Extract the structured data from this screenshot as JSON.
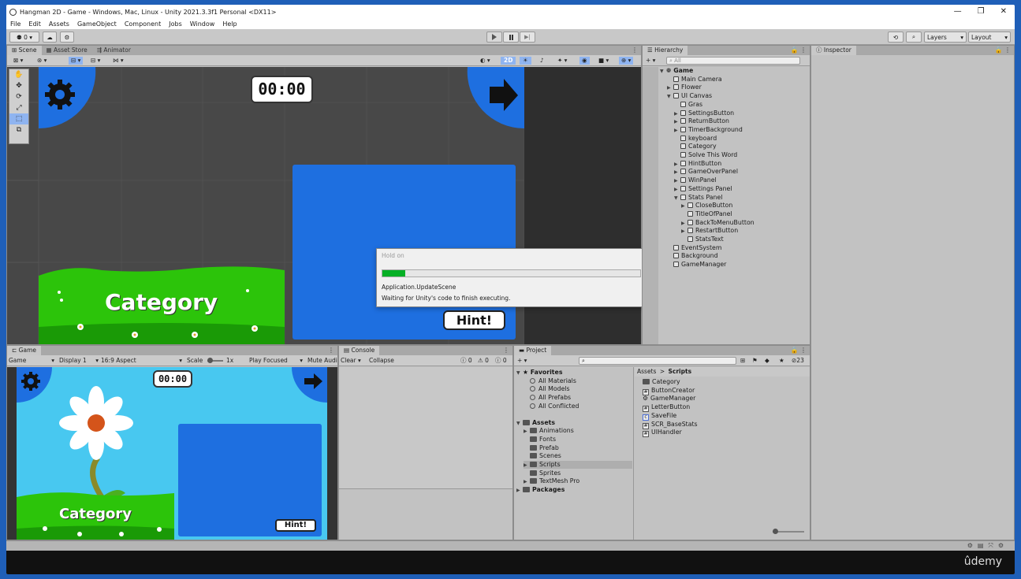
{
  "window": {
    "title": "Hangman 2D - Game - Windows, Mac, Linux - Unity 2021.3.3f1 Personal <DX11>",
    "min": "—",
    "restore": "❐",
    "close": "✕"
  },
  "menu": [
    "File",
    "Edit",
    "Assets",
    "GameObject",
    "Component",
    "Jobs",
    "Window",
    "Help"
  ],
  "toolbar": {
    "account": "⚉ 0 ▾",
    "cloud": "☁",
    "collab": "⚙",
    "layers": "Layers",
    "layout": "Layout"
  },
  "scene": {
    "tabs": [
      "Scene",
      "Asset Store",
      "Animator"
    ],
    "toggle_2d": "2D",
    "timer": "00:00",
    "category": "Category",
    "hint": "Hint!"
  },
  "dialog": {
    "title": "Hold on",
    "line1": "Application.UpdateScene",
    "line2": "Waiting for Unity's code to finish executing.",
    "progress": 0.09
  },
  "hierarchy": {
    "tab": "Hierarchy",
    "search_placeholder": "All",
    "root": "Game",
    "items": [
      {
        "label": "Main Camera",
        "depth": 1,
        "exp": false
      },
      {
        "label": "Flower",
        "depth": 1,
        "exp": true
      },
      {
        "label": "UI Canvas",
        "depth": 1,
        "exp": true,
        "open": true
      },
      {
        "label": "Gras",
        "depth": 2,
        "exp": false
      },
      {
        "label": "SettingsButton",
        "depth": 2,
        "exp": true
      },
      {
        "label": "ReturnButton",
        "depth": 2,
        "exp": true
      },
      {
        "label": "TimerBackground",
        "depth": 2,
        "exp": true
      },
      {
        "label": "keyboard",
        "depth": 2,
        "exp": false
      },
      {
        "label": "Category",
        "depth": 2,
        "exp": false
      },
      {
        "label": "Solve This Word",
        "depth": 2,
        "exp": false
      },
      {
        "label": "HintButton",
        "depth": 2,
        "exp": true
      },
      {
        "label": "GameOverPanel",
        "depth": 2,
        "exp": true
      },
      {
        "label": "WinPanel",
        "depth": 2,
        "exp": true
      },
      {
        "label": "Settings Panel",
        "depth": 2,
        "exp": true
      },
      {
        "label": "Stats Panel",
        "depth": 2,
        "exp": true,
        "open": true
      },
      {
        "label": "CloseButton",
        "depth": 3,
        "exp": true
      },
      {
        "label": "TitleOfPanel",
        "depth": 3,
        "exp": false
      },
      {
        "label": "BackToMenuButton",
        "depth": 3,
        "exp": true
      },
      {
        "label": "RestartButton",
        "depth": 3,
        "exp": true
      },
      {
        "label": "StatsText",
        "depth": 3,
        "exp": false
      },
      {
        "label": "EventSystem",
        "depth": 1,
        "exp": false
      },
      {
        "label": "Background",
        "depth": 1,
        "exp": false
      },
      {
        "label": "GameManager",
        "depth": 1,
        "exp": false
      }
    ]
  },
  "inspector": {
    "tab": "Inspector"
  },
  "game": {
    "tab": "Game",
    "mode": "Game",
    "display": "Display 1",
    "aspect": "16:9 Aspect",
    "scale_label": "Scale",
    "scale_value": "1x",
    "play": "Play Focused",
    "mute": "Mute Audi",
    "timer": "00:00",
    "category": "Category",
    "hint": "Hint!"
  },
  "console": {
    "tab": "Console",
    "clear": "Clear",
    "collapse": "Collapse",
    "count_info": "0",
    "count_warn": "0",
    "count_err": "0"
  },
  "project": {
    "tab": "Project",
    "hidden_count": "23",
    "favorites_label": "Favorites",
    "favorites": [
      "All Materials",
      "All Models",
      "All Prefabs",
      "All Conflicted"
    ],
    "assets_label": "Assets",
    "folders": [
      "Animations",
      "Fonts",
      "Prefab",
      "Scenes",
      "Scripts",
      "Sprites",
      "TextMesh Pro"
    ],
    "packages_label": "Packages",
    "breadcrumb_root": "Assets",
    "breadcrumb_sep": ">",
    "breadcrumb_leaf": "Scripts",
    "files": [
      {
        "name": "Category",
        "kind": "folder"
      },
      {
        "name": "ButtonCreator",
        "kind": "script"
      },
      {
        "name": "GameManager",
        "kind": "manager"
      },
      {
        "name": "LetterButton",
        "kind": "script"
      },
      {
        "name": "SaveFile",
        "kind": "cs"
      },
      {
        "name": "SCR_BaseStats",
        "kind": "script"
      },
      {
        "name": "UIHandler",
        "kind": "script"
      }
    ]
  },
  "watermark": "ûdemy",
  "colors": {
    "accent": "#1e6fe0",
    "scene_bg": "#474747",
    "game_sky": "#48c8f0",
    "grass": "#2cc40a",
    "panel": "#c2c2c2"
  }
}
